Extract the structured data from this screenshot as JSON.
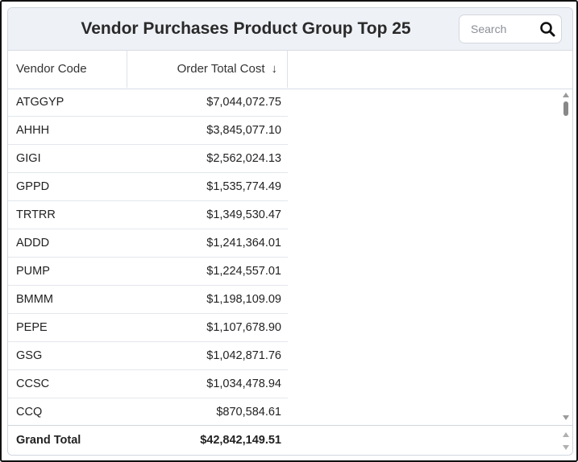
{
  "header": {
    "title": "Vendor Purchases Product Group Top 25",
    "search_placeholder": "Search",
    "search_icon": "search-icon"
  },
  "table": {
    "columns": [
      {
        "label": "Vendor Code"
      },
      {
        "label": "Order Total Cost",
        "sort": "descending",
        "sort_icon": "arrow-down-icon"
      }
    ],
    "rows": [
      {
        "vendor": "ATGGYP",
        "cost": "$7,044,072.75"
      },
      {
        "vendor": "AHHH",
        "cost": "$3,845,077.10"
      },
      {
        "vendor": "GIGI",
        "cost": "$2,562,024.13"
      },
      {
        "vendor": "GPPD",
        "cost": "$1,535,774.49"
      },
      {
        "vendor": "TRTRR",
        "cost": "$1,349,530.47"
      },
      {
        "vendor": "ADDD",
        "cost": "$1,241,364.01"
      },
      {
        "vendor": "PUMP",
        "cost": "$1,224,557.01"
      },
      {
        "vendor": "BMMM",
        "cost": "$1,198,109.09"
      },
      {
        "vendor": "PEPE",
        "cost": "$1,107,678.90"
      },
      {
        "vendor": "GSG",
        "cost": "$1,042,871.76"
      },
      {
        "vendor": "CCSC",
        "cost": "$1,034,478.94"
      },
      {
        "vendor": "CCQ",
        "cost": "$870,584.61"
      }
    ],
    "footer": {
      "label": "Grand Total",
      "total": "$42,842,149.51"
    }
  }
}
